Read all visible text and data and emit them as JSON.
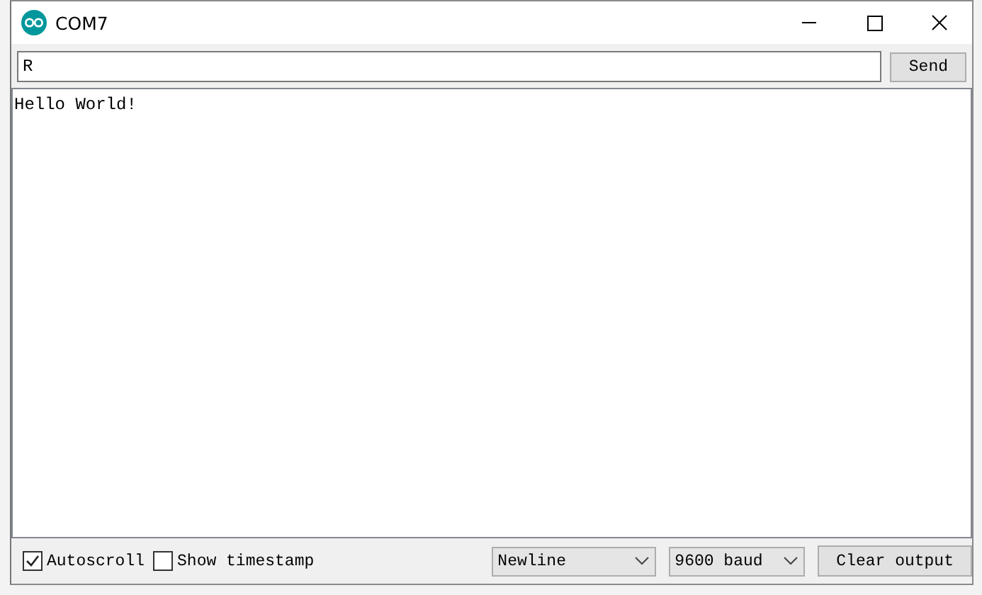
{
  "window": {
    "title": "COM7"
  },
  "send_field": {
    "value": "R"
  },
  "send_button": "Send",
  "output": [
    "Hello World!"
  ],
  "footer": {
    "checkboxes": [
      {
        "label": "Autoscroll",
        "checked": true
      },
      {
        "label": "Show timestamp",
        "checked": false
      }
    ],
    "selects": [
      "Newline",
      "9600 baud"
    ],
    "clear_button": "Clear output"
  }
}
